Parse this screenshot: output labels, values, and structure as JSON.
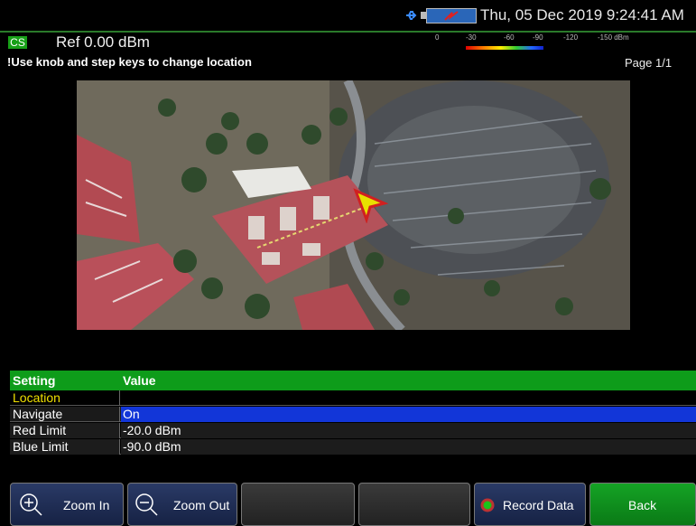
{
  "status": {
    "datetime": "Thu, 05 Dec 2019 9:24:41 AM"
  },
  "header": {
    "mode_badge": "CS",
    "reference": "Ref 0.00 dBm",
    "help": "!Use knob and step keys to change location",
    "page": "Page 1/1"
  },
  "scale": {
    "ticks": [
      "0",
      "-30",
      "-60",
      "-90",
      "-120",
      "-150 dBm"
    ]
  },
  "table": {
    "headers": [
      "Setting",
      "Value"
    ],
    "rows": [
      {
        "setting": "Location",
        "value": ""
      },
      {
        "setting": "Navigate",
        "value": "On"
      },
      {
        "setting": "Red Limit",
        "value": "-20.0 dBm"
      },
      {
        "setting": "Blue Limit",
        "value": "-90.0 dBm"
      }
    ]
  },
  "softkeys": {
    "zoom_in": "Zoom In",
    "zoom_out": "Zoom Out",
    "record": "Record Data",
    "back": "Back"
  },
  "colors": {
    "header_green": "#0e9c1a",
    "selected_blue": "#1236d8",
    "location_yellow": "#f0e000",
    "record_indicator": "#19c419"
  },
  "icons": [
    "usb-icon",
    "battery-icon",
    "zoom-in-icon",
    "zoom-out-icon",
    "record-indicator-icon",
    "location-arrow-icon"
  ]
}
